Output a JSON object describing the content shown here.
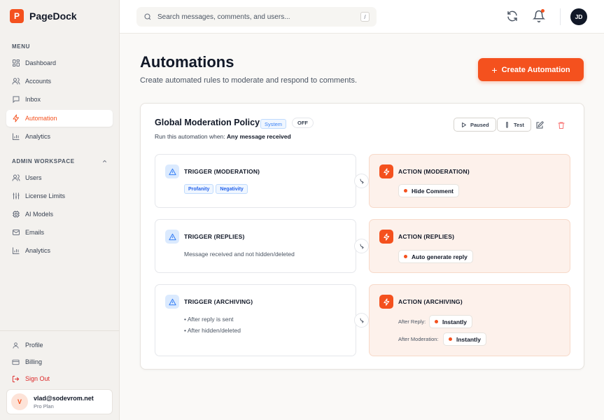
{
  "brand": {
    "logo_letter": "P",
    "name": "PageDock",
    "accent": "#f4511e"
  },
  "sidebar": {
    "menu_label": "MENU",
    "menu_items": [
      {
        "label": "Dashboard",
        "icon": "grid-icon"
      },
      {
        "label": "Accounts",
        "icon": "users-icon"
      },
      {
        "label": "Inbox",
        "icon": "message-icon"
      },
      {
        "label": "Automation",
        "icon": "bolt-icon",
        "active": true
      },
      {
        "label": "Analytics",
        "icon": "bar-chart-icon"
      }
    ],
    "admin_label": "ADMIN WORKSPACE",
    "admin_items": [
      {
        "label": "Users",
        "icon": "users-icon"
      },
      {
        "label": "License Limits",
        "icon": "sliders-icon"
      },
      {
        "label": "AI Models",
        "icon": "cpu-icon"
      },
      {
        "label": "Emails",
        "icon": "mail-icon"
      },
      {
        "label": "Analytics",
        "icon": "bar-chart-icon"
      }
    ],
    "bottom_items": [
      {
        "label": "Profile",
        "icon": "user-icon"
      },
      {
        "label": "Billing",
        "icon": "credit-card-icon"
      },
      {
        "label": "Sign Out",
        "icon": "logout-icon"
      }
    ],
    "user": {
      "avatar_letter": "V",
      "email": "vlad@sodevrom.net",
      "plan": "Pro Plan"
    }
  },
  "header": {
    "search_placeholder": "Search messages, comments, and users...",
    "search_shortcut": "/",
    "avatar_initials": "JD"
  },
  "main": {
    "title": "Automations",
    "subtitle": "Create automated rules to moderate and respond to comments.",
    "create_label": "Create Automation",
    "card": {
      "title": "Global Moderation Policy",
      "system_badge": "System",
      "status_badge": "OFF",
      "desc_prefix": "Run this automation when:",
      "desc_value": "Any message received",
      "paused_label": "Paused",
      "test_label": "Test",
      "rules": [
        {
          "trigger_title": "TRIGGER (MODERATION)",
          "trigger_tags": [
            "Profanity",
            "Negativity"
          ],
          "action_title": "ACTION (MODERATION)",
          "action_value": "Hide Comment"
        },
        {
          "trigger_title": "TRIGGER (REPLIES)",
          "trigger_text": "Message received and not hidden/deleted",
          "action_title": "ACTION (REPLIES)",
          "action_value": "Auto generate reply"
        },
        {
          "trigger_title": "TRIGGER (ARCHIVING)",
          "trigger_bullets": [
            "After reply is sent",
            "After hidden/deleted"
          ],
          "action_title": "ACTION (ARCHIVING)",
          "after_reply_label": "After Reply:",
          "after_reply_value": "Instantly",
          "after_moderation_label": "After Moderation:",
          "after_moderation_value": "Instantly"
        }
      ]
    }
  }
}
